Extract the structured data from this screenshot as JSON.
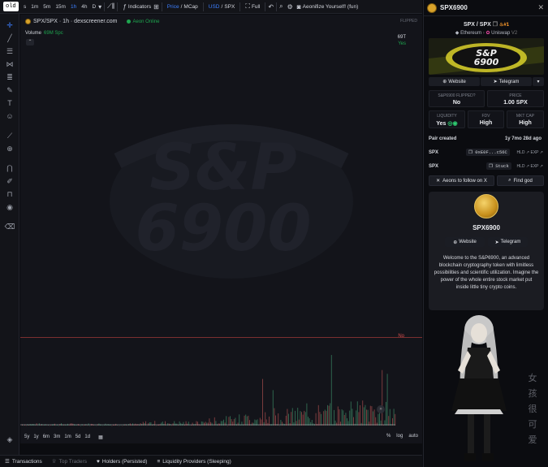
{
  "toolbar": {
    "old_badge": "old",
    "timeframes": [
      "s",
      "1m",
      "5m",
      "15m",
      "1h",
      "4h",
      "D"
    ],
    "active_timeframe": "1h",
    "indicators": "Indicators",
    "price": "Price",
    "mcap": "MCap",
    "usd": "USD",
    "spx": "SPX",
    "full": "Full",
    "aeonify": "Aeonifize Yourself! (fun)"
  },
  "chart": {
    "pair_title": "SPX/SPX · 1h · dexscreener.com",
    "online_status": "Aeon Online",
    "volume_label": "Volume",
    "volume_value": "69M Spc",
    "flipped_tag": "FLIPPED",
    "axis_top_value": "69T",
    "axis_top_sub": "Yes",
    "no_label": "No",
    "ranges": [
      "5y",
      "1y",
      "6m",
      "3m",
      "1m",
      "5d",
      "1d"
    ],
    "percent": "%",
    "log": "log",
    "auto": "auto",
    "watermark_top": "S&P",
    "watermark_bottom": "6900"
  },
  "bottom_tabs": [
    {
      "label": "Transactions",
      "dim": false
    },
    {
      "label": "Top Traders",
      "dim": true
    },
    {
      "label": "Holders (Persisted)",
      "dim": false
    },
    {
      "label": "Liquidity Providers (Sleeping)",
      "dim": false
    }
  ],
  "panel": {
    "token_name": "SPX6900",
    "pair": "SPX / SPX",
    "rank": "#1",
    "chain": "Ethereum",
    "dex": "Uniswap",
    "dex_version": "V2",
    "website": "Website",
    "telegram": "Telegram",
    "stats": [
      {
        "key": "S&P6900 FLIPPED?",
        "value": "No"
      },
      {
        "key": "PRICE",
        "value": "1.00 SPX"
      },
      {
        "key": "LIQUIDITY",
        "value": "Yes"
      },
      {
        "key": "FDV",
        "value": "High"
      },
      {
        "key": "MKT CAP",
        "value": "High"
      }
    ],
    "pair_created_label": "Pair created",
    "pair_created_value": "1y 7mo 28d ago",
    "row1_label": "SPX",
    "row1_chip": "0xE0F...c56C",
    "row2_label": "SPX",
    "row2_chip": "Stuck",
    "hld": "HLD",
    "exp": "EXP",
    "follow_btn": "Aeons to follow on X",
    "find_god_btn": "Find god",
    "info_title": "SPX6900",
    "info_website": "Website",
    "info_telegram": "Telegram",
    "info_desc": "Welcome to the S&P6900, an advanced blockchain cryptography token with limitless possibilities and scientific utilization. Imagine the power of the whole entire stock market put inside little tiny crypto coins.",
    "kanji": [
      "女",
      "孩",
      "很",
      "可",
      "爱"
    ]
  },
  "colors": {
    "accent_blue": "#3d7fff",
    "online_green": "#1ea54f",
    "no_red": "#d34c4c"
  }
}
